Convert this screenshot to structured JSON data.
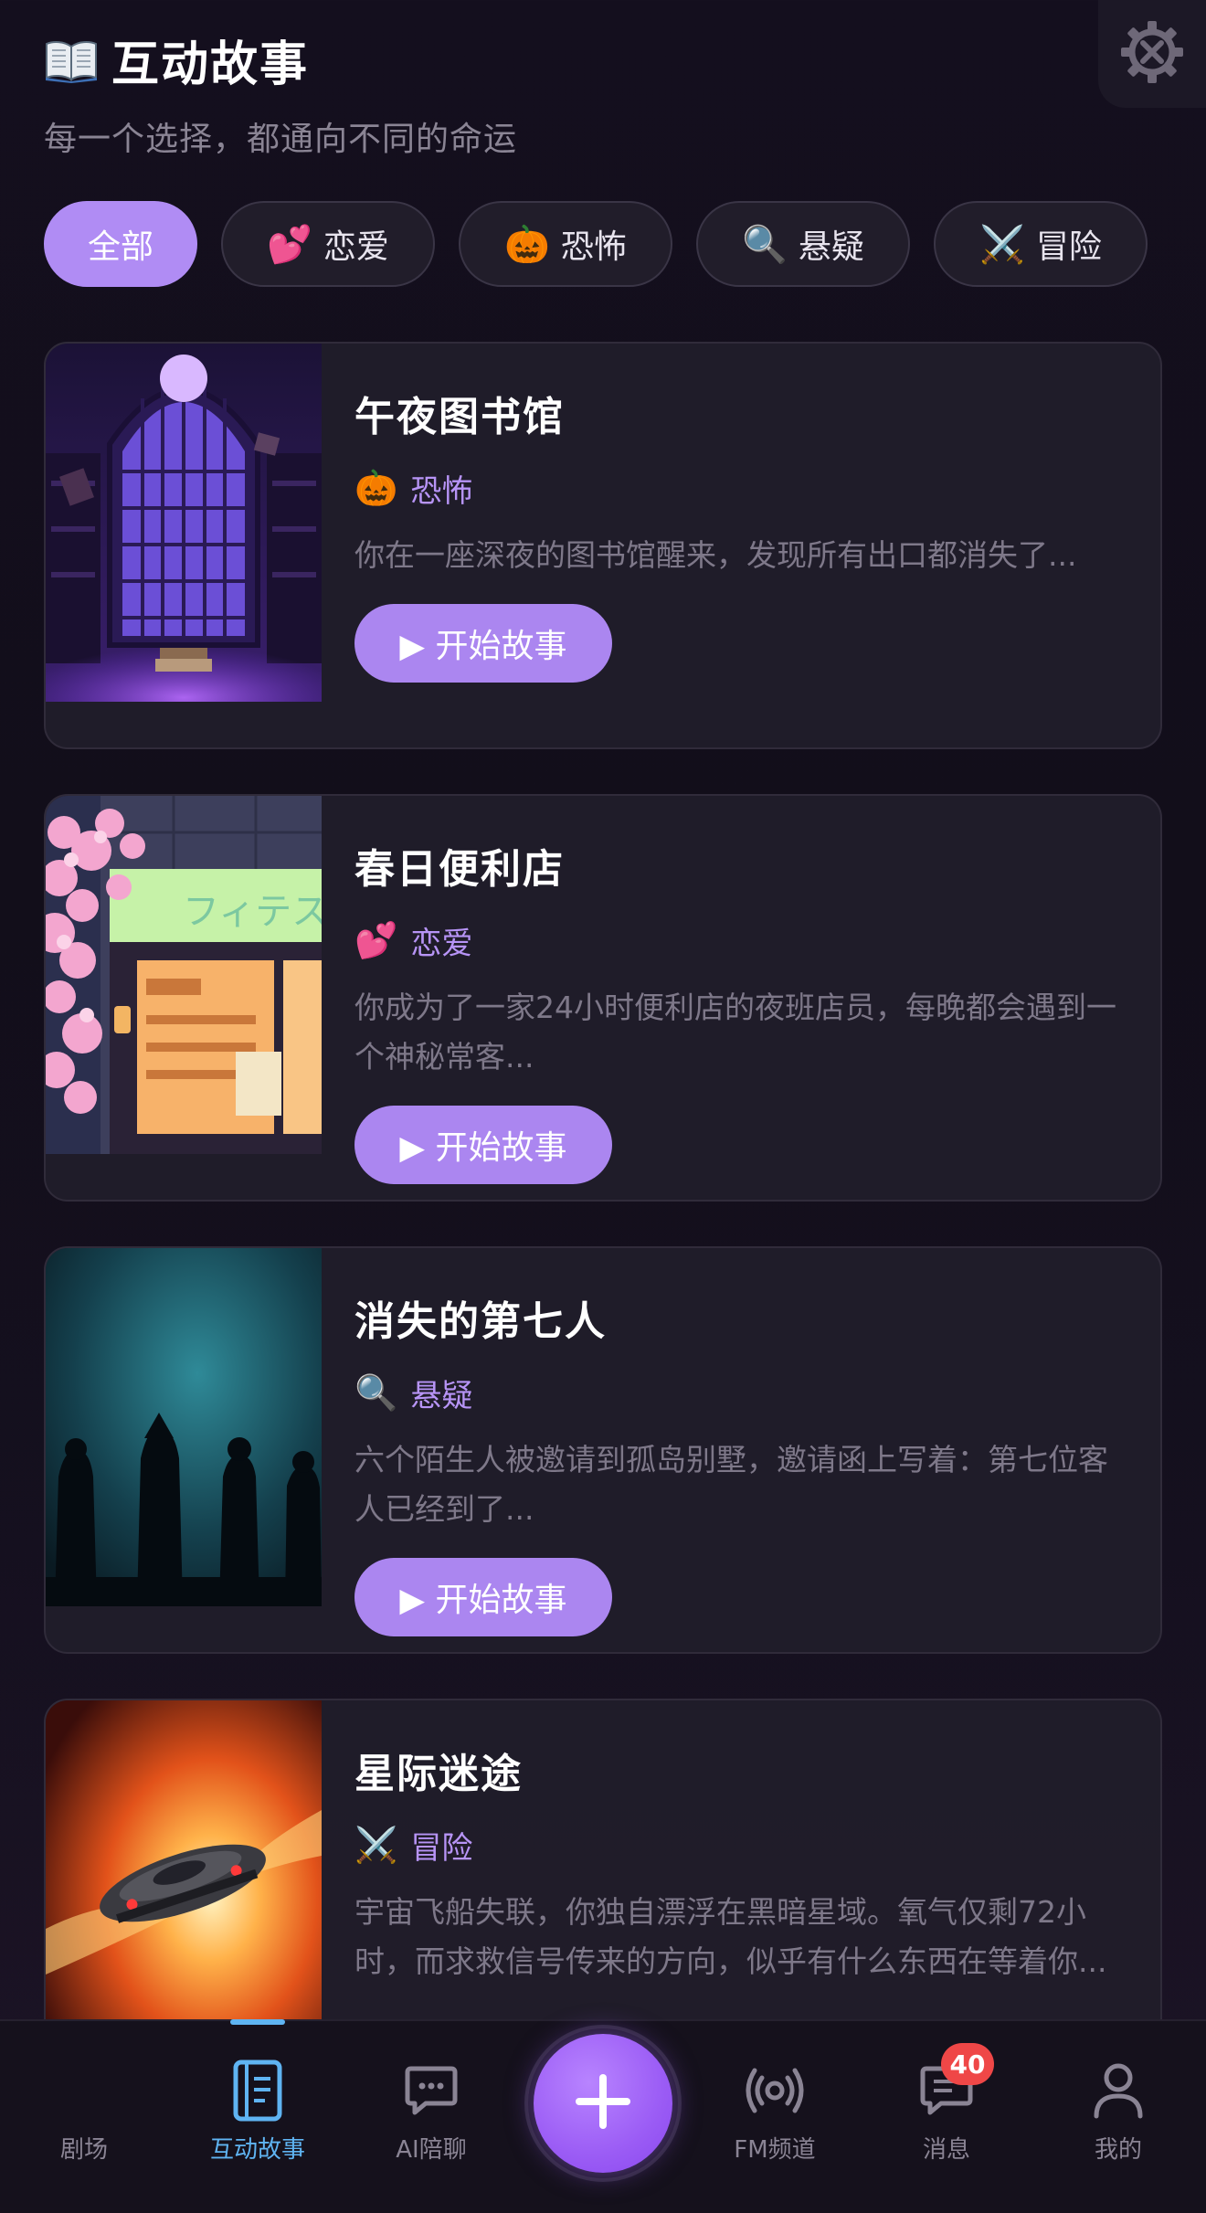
{
  "header": {
    "title": "互动故事",
    "subtitle": "每一个选择，都通向不同的命运"
  },
  "filters": [
    {
      "label": "全部",
      "emoji": "",
      "active": true
    },
    {
      "label": "恋爱",
      "emoji": "💕",
      "active": false
    },
    {
      "label": "恐怖",
      "emoji": "🎃",
      "active": false
    },
    {
      "label": "悬疑",
      "emoji": "🔍",
      "active": false
    },
    {
      "label": "冒险",
      "emoji": "⚔️",
      "active": false
    }
  ],
  "stories": [
    {
      "title": "午夜图书馆",
      "genre_emoji": "🎃",
      "genre": "恐怖",
      "description": "你在一座深夜的图书馆醒来，发现所有出口都消失了...",
      "button": "▶ 开始故事"
    },
    {
      "title": "春日便利店",
      "genre_emoji": "💕",
      "genre": "恋爱",
      "description": "你成为了一家24小时便利店的夜班店员，每晚都会遇到一个神秘常客...",
      "button": "▶ 开始故事"
    },
    {
      "title": "消失的第七人",
      "genre_emoji": "🔍",
      "genre": "悬疑",
      "description": "六个陌生人被邀请到孤岛别墅，邀请函上写着：第七位客人已经到了...",
      "button": "▶ 开始故事"
    },
    {
      "title": "星际迷途",
      "genre_emoji": "⚔️",
      "genre": "冒险",
      "description": "宇宙飞船失联，你独自漂浮在黑暗星域。氧气仅剩72小时，而求救信号传来的方向，似乎有什么东西在等着你...",
      "button": ""
    }
  ],
  "tabbar": {
    "items": [
      {
        "label": "剧场",
        "icon": "theater-icon"
      },
      {
        "label": "互动故事",
        "icon": "book-icon",
        "active": true
      },
      {
        "label": "AI陪聊",
        "icon": "chat-icon"
      },
      {
        "label": "FM频道",
        "icon": "radio-icon"
      },
      {
        "label": "消息",
        "icon": "message-icon"
      },
      {
        "label": "我的",
        "icon": "user-icon"
      }
    ],
    "message_badge": "40"
  },
  "colors": {
    "accent": "#ab86f0",
    "genre_text": "#b794f6",
    "active_tab": "#5fb4f2",
    "badge": "#ef4747"
  }
}
